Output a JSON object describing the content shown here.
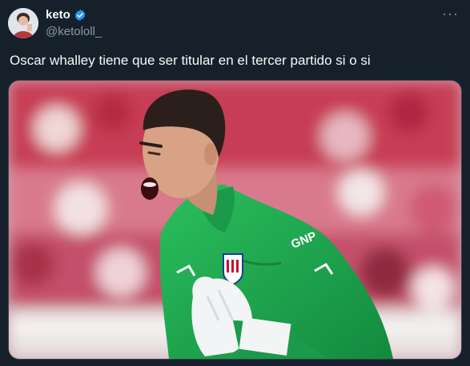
{
  "tweet": {
    "author_name": "keto",
    "author_handle": "@ketololl_",
    "text": "Oscar whalley tiene que ser titular en el tercer partido si o si",
    "more_label": "···"
  },
  "media": {
    "alt": ""
  },
  "colors": {
    "background": "#15202b",
    "verified_badge": "#1d9bf0",
    "jersey": "#22a651",
    "secondary_text": "#8b98a5"
  }
}
